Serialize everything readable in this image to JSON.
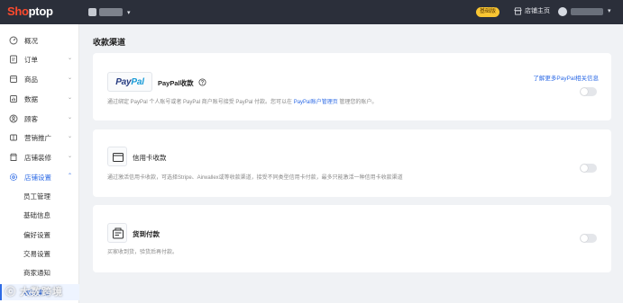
{
  "brand": {
    "logo_part1": "Sho",
    "logo_part2": "ptop"
  },
  "topbar": {
    "store_caret": "▾",
    "plan_badge": "基础版",
    "shop_home": "店铺主页",
    "user_caret": "▾"
  },
  "sidebar": {
    "items": [
      {
        "label": "概况",
        "icon": "dashboard-icon"
      },
      {
        "label": "订单",
        "icon": "order-icon",
        "chev": "⌄"
      },
      {
        "label": "商品",
        "icon": "product-icon",
        "chev": "⌄"
      },
      {
        "label": "数据",
        "icon": "data-icon",
        "chev": "⌄"
      },
      {
        "label": "顾客",
        "icon": "customer-icon",
        "chev": "⌄"
      },
      {
        "label": "营销推广",
        "icon": "marketing-icon",
        "chev": "⌄"
      },
      {
        "label": "店铺装修",
        "icon": "decorate-icon",
        "chev": "⌄"
      },
      {
        "label": "店铺设置",
        "icon": "settings-icon",
        "chev": "⌃"
      }
    ],
    "sub_items": [
      {
        "label": "员工管理"
      },
      {
        "label": "基础信息"
      },
      {
        "label": "偏好设置"
      },
      {
        "label": "交易设置"
      },
      {
        "label": "商家通知"
      },
      {
        "label": "收款渠道"
      }
    ]
  },
  "main": {
    "title": "收款渠道",
    "paypal": {
      "logo_p1": "Pay",
      "logo_p2": "Pal",
      "title": "PayPal收款",
      "link": "了解更多PayPal相关信息",
      "desc_before": "通过绑定 PayPal 个人账号或者 PayPal 商户账号接受 PayPal 付款。您可以在 ",
      "desc_link": "PayPal账户管理页",
      "desc_after": " 管理您的账户。",
      "enabled": false
    },
    "credit_card": {
      "title": "信用卡收款",
      "desc": "通过激活信用卡收款，可选择Stripe、Airwallex或等收款渠道，接受不同类型信用卡付款，最多只能激活一种信用卡收款渠道",
      "enabled": false
    },
    "cod": {
      "title": "货到付款",
      "desc": "买家收到货，验货后再付款。",
      "enabled": false
    }
  },
  "watermark": "ⓒ 大数跨境"
}
